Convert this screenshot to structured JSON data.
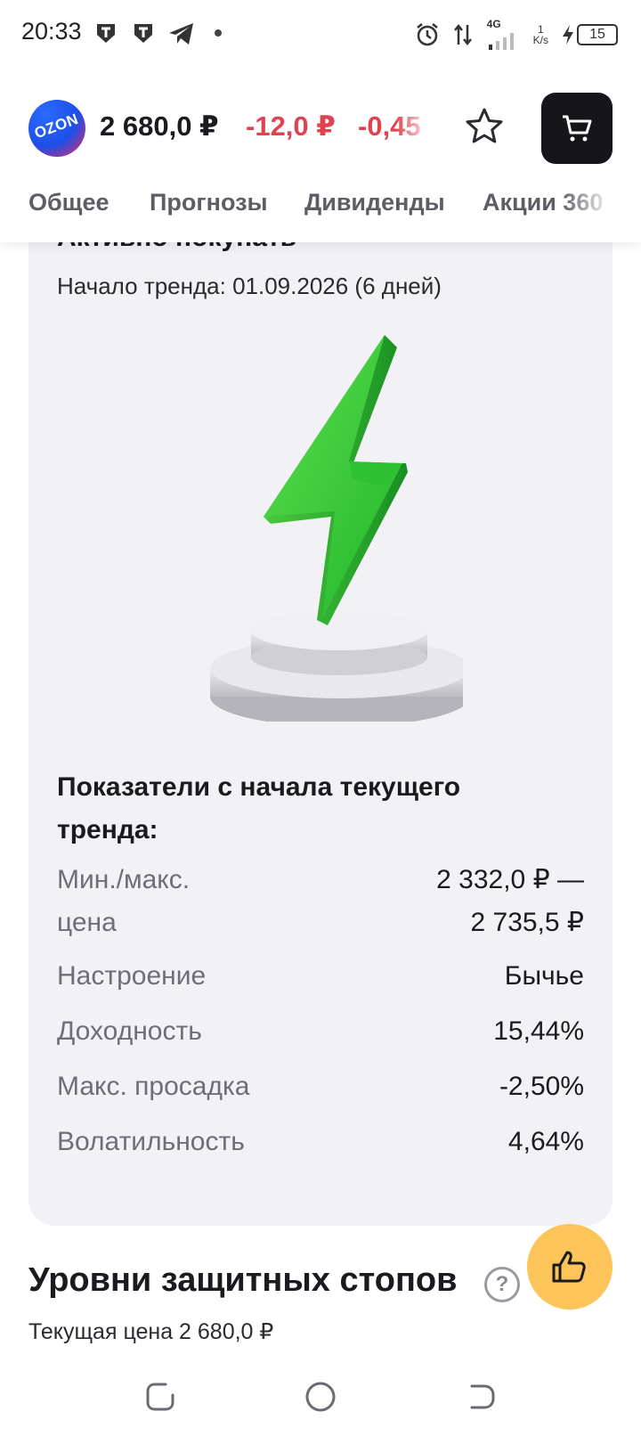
{
  "status_bar": {
    "time": "20:33",
    "network": "4G",
    "speed_value": "1",
    "speed_unit": "K/s",
    "battery": "15"
  },
  "header": {
    "logo_text": "OZON",
    "price": "2 680,0 ₽",
    "change_abs": "-12,0 ₽",
    "change_pct": "-0,45",
    "change_color": "#e0424f",
    "icons": [
      "star-icon",
      "cart-icon"
    ]
  },
  "tabs": [
    {
      "label": "Общее"
    },
    {
      "label": "Прогнозы"
    },
    {
      "label": "Дивиденды"
    },
    {
      "label": "Акции 360"
    }
  ],
  "trend_card": {
    "title": "Активно покупать",
    "trend_start": "Начало тренда: 01.09.2026 (6 дней)",
    "metrics_title": "Показатели с начала текущего тренда:",
    "metrics": [
      {
        "label_line1": "Мин./макс.",
        "label_line2": "цена",
        "value_line1": "2 332,0 ₽ —",
        "value_line2": "2 735,5 ₽"
      },
      {
        "label": "Настроение",
        "value": "Бычье"
      },
      {
        "label": "Доходность",
        "value": "15,44%"
      },
      {
        "label": "Макс. просадка",
        "value": "-2,50%"
      },
      {
        "label": "Волатильность",
        "value": "4,64%"
      }
    ]
  },
  "stops_section": {
    "title": "Уровни защитных стопов",
    "help_symbol": "?",
    "current_price": "Текущая цена 2 680,0 ₽"
  },
  "colors": {
    "accent_yellow": "#fdc45a",
    "card_bg": "#f1f1f6",
    "bolt_green": "#3ecf3a"
  }
}
